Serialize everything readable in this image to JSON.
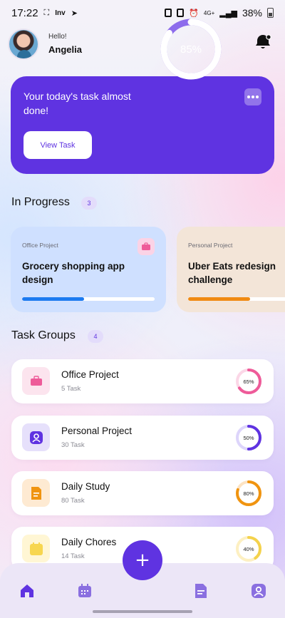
{
  "status_bar": {
    "time": "17:22",
    "network": "4G+",
    "battery": "38%",
    "app_tag": "Inv"
  },
  "header": {
    "greeting": "Hello!",
    "user_name": "Angelia"
  },
  "hero": {
    "message": "Your today's task almost done!",
    "button_label": "View Task",
    "progress_label": "85%",
    "progress": 0.85
  },
  "in_progress": {
    "title": "In Progress",
    "count": "3",
    "cards": [
      {
        "type": "Office Project",
        "name": "Grocery shopping app design",
        "progress": 0.47,
        "bar_color": "#1d7bf0"
      },
      {
        "type": "Personal Project",
        "name": "Uber Eats redesign challenge",
        "progress": 0.58,
        "bar_color": "#f08a12"
      }
    ]
  },
  "task_groups": {
    "title": "Task Groups",
    "count": "4",
    "items": [
      {
        "name": "Office Project",
        "count": "5 Task",
        "percent_label": "65%",
        "progress": 0.65,
        "color": "#ee5b99",
        "track": "#fbd7e7",
        "icon_bg": "#fce4ee",
        "icon": "briefcase-icon"
      },
      {
        "name": "Personal Project",
        "count": "30 Task",
        "percent_label": "50%",
        "progress": 0.5,
        "color": "#5f33e1",
        "track": "#ddd5fb",
        "icon_bg": "#e6e0fb",
        "icon": "user-icon"
      },
      {
        "name": "Daily Study",
        "count": "80 Task",
        "percent_label": "80%",
        "progress": 0.8,
        "color": "#f09410",
        "track": "#fde3c2",
        "icon_bg": "#feead2",
        "icon": "document-icon"
      },
      {
        "name": "Daily Chores",
        "count": "14 Task",
        "percent_label": "40%",
        "progress": 0.4,
        "color": "#f4d24c",
        "track": "#fdf0c2",
        "icon_bg": "#fff6d4",
        "icon": "calendar-icon"
      }
    ]
  },
  "bottom_nav": {
    "items": [
      "home-icon",
      "calendar-icon",
      "document-icon",
      "profile-icon"
    ],
    "fab": "+",
    "accent": "#5f33e1"
  }
}
